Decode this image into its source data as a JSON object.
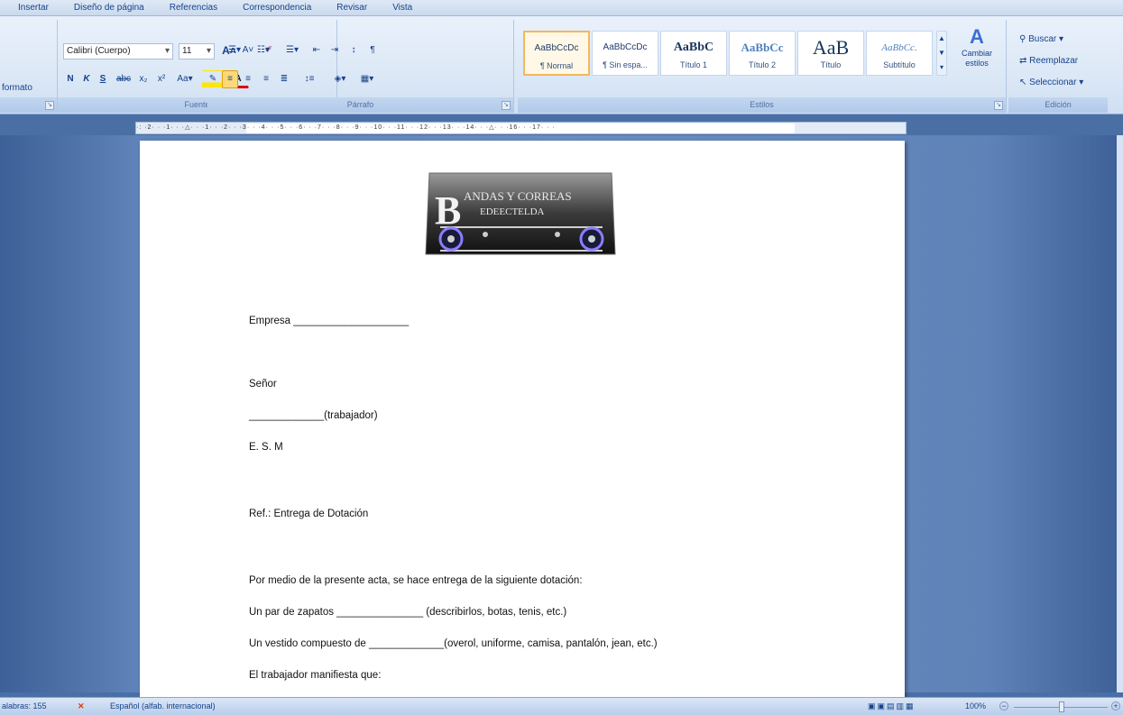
{
  "tabs": [
    "Insertar",
    "Diseño de página",
    "Referencias",
    "Correspondencia",
    "Revisar",
    "Vista"
  ],
  "ribbon": {
    "left_fragment": "formato",
    "font": {
      "name": "Calibri (Cuerpo)",
      "size": "11",
      "label": "Fuente"
    },
    "paragraph": {
      "label": "Párrafo"
    },
    "styles": {
      "label": "Estilos",
      "items": [
        {
          "sample": "AaBbCcDc",
          "name": "¶ Normal"
        },
        {
          "sample": "AaBbCcDc",
          "name": "¶ Sin espa..."
        },
        {
          "sample": "AaBbC",
          "name": "Título 1"
        },
        {
          "sample": "AaBbCc",
          "name": "Título 2"
        },
        {
          "sample": "AaB",
          "name": "Título"
        },
        {
          "sample": "AaBbCc.",
          "name": "Subtítulo"
        }
      ],
      "change_label": "Cambiar estilos"
    },
    "editing": {
      "label": "Edición",
      "find": "Buscar",
      "replace": "Reemplazar",
      "select": "Seleccionar"
    }
  },
  "document": {
    "logo_text_1": "ANDAS Y CORREAS",
    "logo_text_2": "EDEECTELDA",
    "lines": [
      "Empresa ____________________",
      "Señor",
      "_____________(trabajador)",
      "E. S. M",
      "Ref.: Entrega de Dotación",
      "Por medio de la presente acta, se hace entrega de la siguiente dotación:",
      "Un par de zapatos _______________ (describirlos, botas, tenis, etc.)",
      "Un vestido compuesto de  _____________(overol, uniforme, camisa, pantalón, jean, etc.)",
      "El trabajador manifiesta que:"
    ]
  },
  "status": {
    "words": "alabras: 155",
    "language": "Español (alfab. internacional)",
    "zoom": "100%"
  }
}
